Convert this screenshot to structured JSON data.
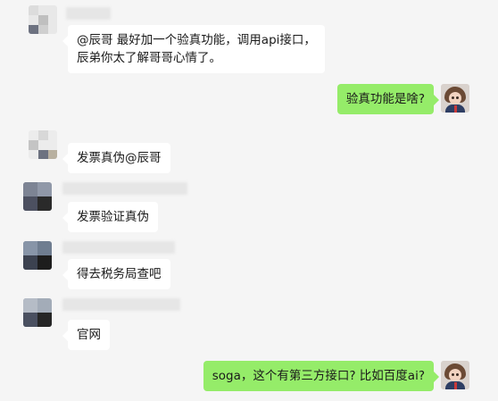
{
  "colors": {
    "background": "#f5f5f5",
    "incoming_bubble": "#ffffff",
    "outgoing_bubble": "#95ec69"
  },
  "messages": [
    {
      "side": "left",
      "text": "@辰哥 最好加一个验真功能，调用api接口，",
      "text2": "辰弟你太了解哥哥心情了。"
    },
    {
      "side": "right",
      "text": "验真功能是啥?"
    },
    {
      "side": "left",
      "text": "发票真伪@辰哥"
    },
    {
      "side": "left",
      "text": "发票验证真伪"
    },
    {
      "side": "left",
      "text": "得去税务局查吧"
    },
    {
      "side": "left",
      "text": "官网"
    },
    {
      "side": "right",
      "text": "soga，这个有第三方接口? 比如百度ai?"
    }
  ],
  "icons": {
    "user_avatar": "user-avatar-icon",
    "contact_avatar": "blurred-avatar-icon"
  }
}
